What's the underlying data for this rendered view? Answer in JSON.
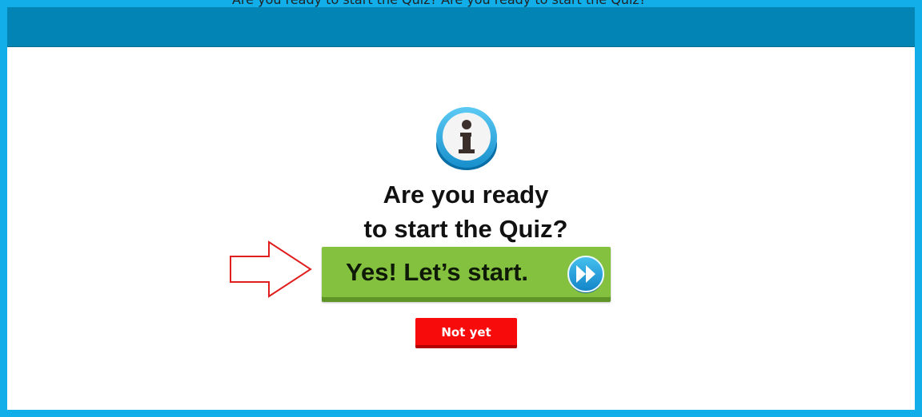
{
  "header": {
    "top_text": "Are you ready to start the Quiz? Are you ready to start the Quiz?"
  },
  "dialog": {
    "question_line1": "Are you ready",
    "question_line2": "to start the Quiz?",
    "start_button_label": "Yes! Let’s start.",
    "not_yet_button_label": "Not yet"
  },
  "colors": {
    "frame": "#12aee9",
    "header_bar": "#0285b4",
    "start_button": "#84c13f",
    "not_yet_button": "#f80b0b",
    "arrow_outline": "#e01e1e"
  },
  "icons": {
    "info": "info-icon",
    "forward": "fast-forward-icon",
    "pointer": "arrow-right-icon"
  }
}
